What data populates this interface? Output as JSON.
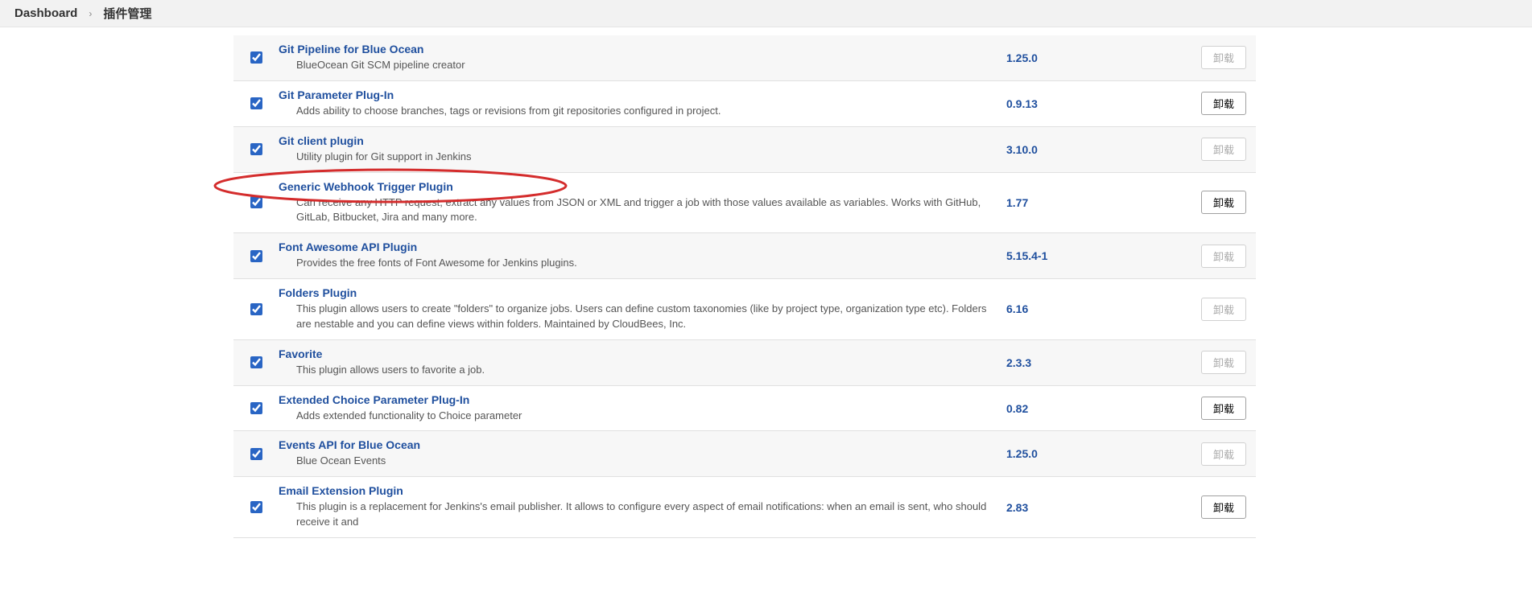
{
  "breadcrumb": {
    "dashboard": "Dashboard",
    "page": "插件管理"
  },
  "action_disabled_label": "卸载",
  "action_enabled_label": "卸载",
  "rows": [
    {
      "checked": true,
      "alt": true,
      "name": "Git Pipeline for Blue Ocean",
      "desc": "BlueOcean Git SCM pipeline creator",
      "version": "1.25.0",
      "action_enabled": false
    },
    {
      "checked": true,
      "alt": false,
      "name": "Git Parameter Plug-In",
      "desc": "Adds ability to choose branches, tags or revisions from git repositories configured in project.",
      "version": "0.9.13",
      "action_enabled": true
    },
    {
      "checked": true,
      "alt": true,
      "name": "Git client plugin",
      "desc": "Utility plugin for Git support in Jenkins",
      "version": "3.10.0",
      "action_enabled": false
    },
    {
      "checked": true,
      "alt": false,
      "highlight": true,
      "name": "Generic Webhook Trigger Plugin",
      "desc": "Can receive any HTTP request, extract any values from JSON or XML and trigger a job with those values available as variables. Works with GitHub, GitLab, Bitbucket, Jira and many more.",
      "version": "1.77",
      "action_enabled": true
    },
    {
      "checked": true,
      "alt": true,
      "name": "Font Awesome API Plugin",
      "desc": "Provides the free fonts of Font Awesome for Jenkins plugins.",
      "version": "5.15.4-1",
      "action_enabled": false
    },
    {
      "checked": true,
      "alt": false,
      "name": "Folders Plugin",
      "desc": "This plugin allows users to create \"folders\" to organize jobs. Users can define custom taxonomies (like by project type, organization type etc). Folders are nestable and you can define views within folders. Maintained by CloudBees, Inc.",
      "version": "6.16",
      "action_enabled": false
    },
    {
      "checked": true,
      "alt": true,
      "name": "Favorite",
      "desc": "This plugin allows users to favorite a job.",
      "version": "2.3.3",
      "action_enabled": false
    },
    {
      "checked": true,
      "alt": false,
      "name": "Extended Choice Parameter Plug-In",
      "desc": "Adds extended functionality to Choice parameter",
      "version": "0.82",
      "action_enabled": true
    },
    {
      "checked": true,
      "alt": true,
      "name": "Events API for Blue Ocean",
      "desc": "Blue Ocean Events",
      "version": "1.25.0",
      "action_enabled": false
    },
    {
      "checked": true,
      "alt": false,
      "name": "Email Extension Plugin",
      "desc": "This plugin is a replacement for Jenkins's email publisher. It allows to configure every aspect of email notifications: when an email is sent, who should receive it and",
      "version": "2.83",
      "action_enabled": true
    }
  ]
}
